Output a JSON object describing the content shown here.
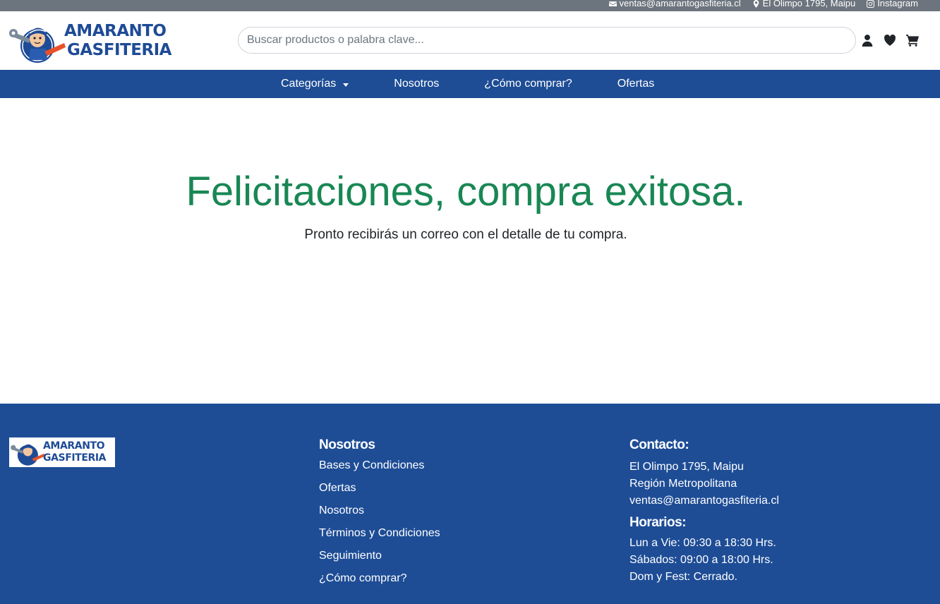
{
  "topbar": {
    "email": "ventas@amarantogasfiteria.cl",
    "address": "El Olimpo 1795, Maipu",
    "instagram": "Instagram"
  },
  "header": {
    "logo_line1": "AMARANTO",
    "logo_line2": "GASFITERIA",
    "search_placeholder": "Buscar productos o palabra clave...",
    "icons": [
      "user-icon",
      "heart-icon",
      "cart-icon"
    ]
  },
  "nav": {
    "items": [
      {
        "label": "Categorías",
        "dropdown": true
      },
      {
        "label": "Nosotros"
      },
      {
        "label": "¿Cómo comprar?"
      },
      {
        "label": "Ofertas"
      }
    ]
  },
  "main": {
    "title": "Felicitaciones, compra exitosa.",
    "subtitle": "Pronto recibirás un correo con el detalle de tu compra."
  },
  "footer": {
    "logo_line1": "AMARANTO",
    "logo_line2": "GASFITERIA",
    "links_title": "Nosotros",
    "links": [
      "Bases y Condiciones",
      "Ofertas",
      "Nosotros",
      "Términos y Condiciones",
      "Seguimiento",
      "¿Cómo comprar?"
    ],
    "contact_title": "Contacto:",
    "contact_lines": [
      "El Olimpo 1795, Maipu",
      "Región Metropolitana",
      "ventas@amarantogasfiteria.cl"
    ],
    "hours_title": "Horarios:",
    "hours_lines": [
      "Lun a Vie: 09:30 a 18:30 Hrs.",
      "Sábados: 09:00 a 18:00 Hrs.",
      "Dom y Fest: Cerrado."
    ]
  },
  "colors": {
    "brand_blue": "#1e4d96",
    "topbar_gray": "#6c757d",
    "success_green": "#198754"
  }
}
